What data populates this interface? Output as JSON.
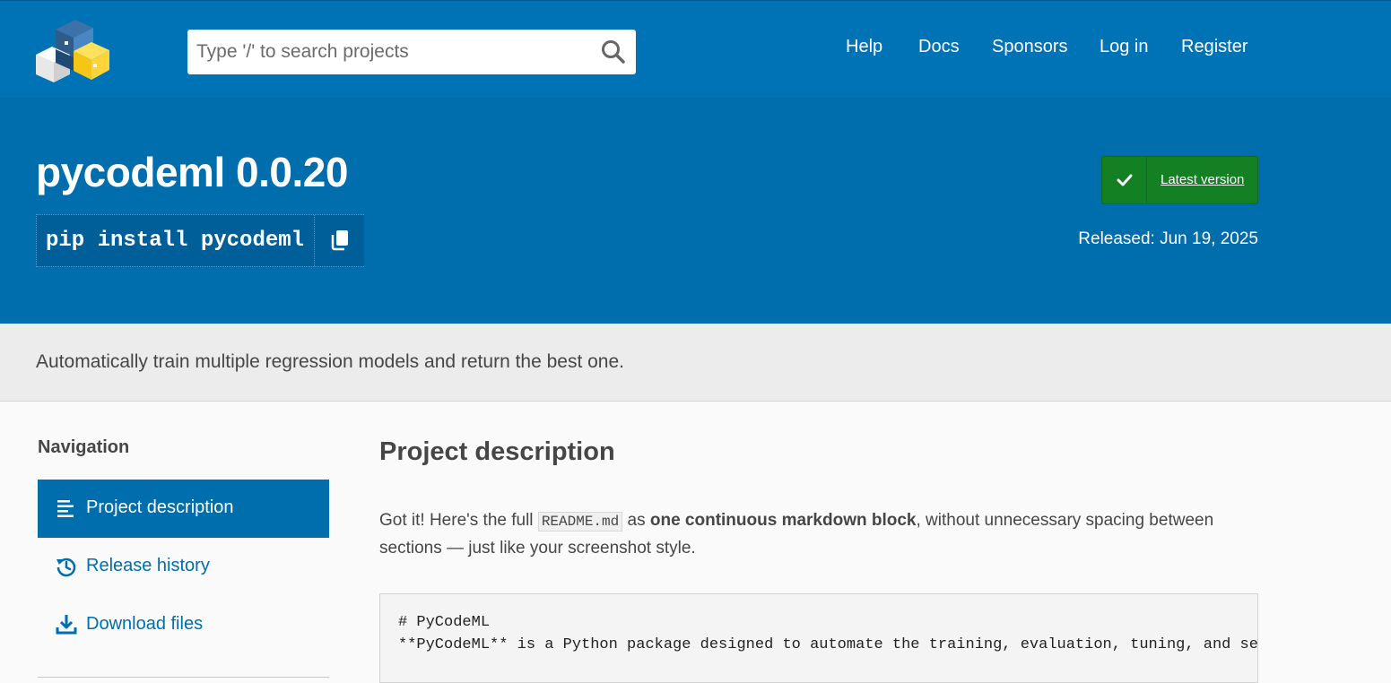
{
  "header": {
    "search_placeholder": "Type '/' to search projects",
    "nav": [
      "Help",
      "Docs",
      "Sponsors",
      "Log in",
      "Register"
    ]
  },
  "package": {
    "title": "pycodeml 0.0.20",
    "pip_command": "pip install pycodeml",
    "latest_label": "Latest version",
    "released": "Released: Jun 19, 2025"
  },
  "summary": "Automatically train multiple regression models and return the best one.",
  "sidebar": {
    "title": "Navigation",
    "items": [
      {
        "label": "Project description",
        "icon": "align-left-icon",
        "active": true
      },
      {
        "label": "Release history",
        "icon": "history-icon",
        "active": false
      },
      {
        "label": "Download files",
        "icon": "download-icon",
        "active": false
      }
    ]
  },
  "description": {
    "title": "Project description",
    "para_start": "Got it! Here's the full ",
    "inline_code": "README.md",
    "para_mid": " as ",
    "para_bold": "one continuous markdown block",
    "para_end": ", without unnecessary spacing between sections — just like your screenshot style.",
    "code_lines": [
      "# PyCodeML",
      "**PyCodeML** is a Python package designed to automate the training, evaluation, tuning, and se"
    ]
  },
  "colors": {
    "header_blue": "#0073b7",
    "hero_blue": "#006dad",
    "latest_green": "#148024",
    "summary_bg": "#ececec"
  }
}
